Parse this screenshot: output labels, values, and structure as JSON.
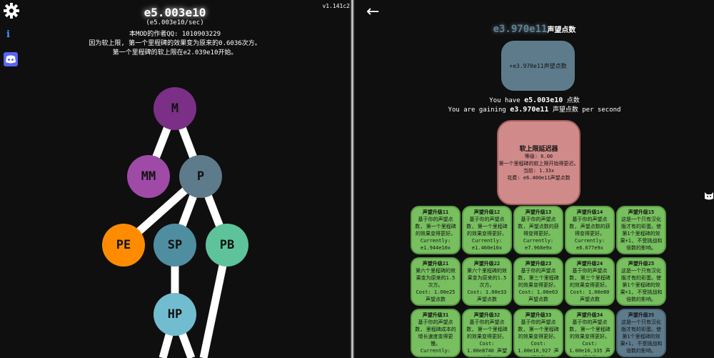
{
  "version": "v1.141c2",
  "left": {
    "points": "e5.003e10",
    "per_sec": "(e5.003e10/sec)",
    "author_line": "本MOD的作者QQ: 1010903229",
    "softcap_line": "因为软上限, 第一个里程碑的效果变为原来的0.6036次方。",
    "softcap_start_line": "第一个里程碑的软上限在e2.039e10开始。",
    "nodes": [
      {
        "key": "m",
        "label": "M",
        "color": "#7b2f86"
      },
      {
        "key": "mm",
        "label": "MM",
        "color": "#a04aa8"
      },
      {
        "key": "p",
        "label": "P",
        "color": "#5e7b8c"
      },
      {
        "key": "pe",
        "label": "PE",
        "color": "#ff8c00"
      },
      {
        "key": "sp",
        "label": "SP",
        "color": "#4f8ea0"
      },
      {
        "key": "pb",
        "label": "PB",
        "color": "#5ec39a"
      },
      {
        "key": "hp",
        "label": "HP",
        "color": "#72bccf"
      }
    ],
    "icons": {
      "settings": "gear-icon",
      "info": "info-icon",
      "discord": "discord-icon"
    }
  },
  "right": {
    "back_arrow": "←",
    "prestige_points": "e3.970e11",
    "prestige_name": "声望点数",
    "reset_button": "+e3.970e11声望点数",
    "you_have_prefix": "You have",
    "you_have_value": "e5.003e10",
    "you_have_suffix": "点数",
    "gaining_prefix": "You are gaining",
    "gaining_value": "e3.970e11",
    "gaining_suffix": "声望点数 per second",
    "buyable": {
      "title": "软上限延迟器",
      "level": "等级: 6.00",
      "desc": "第一个里程碑的软上限开始得更迟。当前: 1.33x",
      "cost": "花费: e6.400e11声望点数"
    },
    "upgrades": [
      {
        "title": "声望升级11",
        "desc": "基于你的声望点数, 第一个里程碑的效果变得更好。",
        "extra": "Currently: e1.944e10x"
      },
      {
        "title": "声望升级12",
        "desc": "基于你的声望点数, 第一个里程碑的效果变得更好。",
        "extra": "Currently: e1.460e10x"
      },
      {
        "title": "声望升级13",
        "desc": "基于你的声望点数, 声望点数的获得变得更好。",
        "extra": "Currently: e7.968e9x"
      },
      {
        "title": "声望升级14",
        "desc": "基于你的声望点数, 声望点数的获得变得更好。",
        "extra": "Currently: e6.677e9x"
      },
      {
        "title": "声望升级15",
        "desc": "这是一个只有汉化版才有的彩蛋。使第1个里程碑的效果+1, 不受挑战和倍数的影响。",
        "extra": ""
      },
      {
        "title": "声望升级21",
        "desc": "第六个里程碑的效果变为原来的1.5次方。",
        "extra": "Cost: 1.00e25 声望点数"
      },
      {
        "title": "声望升级22",
        "desc": "第六个里程碑的效果变为原来的1.5次方。",
        "extra": "Cost: 1.00e33 声望点数"
      },
      {
        "title": "声望升级23",
        "desc": "基于你的声望点数, 第三个里程碑的效果变得更好。",
        "extra": "Cost: 1.00e63 声望点数"
      },
      {
        "title": "声望升级24",
        "desc": "基于你的声望点数, 第三个里程碑的效果变得更好。",
        "extra": "Cost: 1.00e80 声望点数"
      },
      {
        "title": "声望升级25",
        "desc": "这是一个只有汉化版才有的彩蛋。使第1个里程碑的效果+1, 不受挑战和倍数的影响。",
        "extra": ""
      },
      {
        "title": "声望升级31",
        "desc": "基于你的声望点数, 里程碑成本的增长速度变得更慢。",
        "extra": "Currently: 1.5965x"
      },
      {
        "title": "声望升级32",
        "desc": "基于你的声望点数, 第一个里程碑的效果变得更好。",
        "extra": "Cost: 1.00e8740 声望点数"
      },
      {
        "title": "声望升级33",
        "desc": "基于你的声望点数, 第一个里程碑的效果变得更好。",
        "extra": "Cost: 1.00e10,927 声望点数"
      },
      {
        "title": "声望升级34",
        "desc": "基于你的声望点数, 第一个里程碑的效果变得更好。",
        "extra": "Cost: 1.00e16,335 声望点数"
      },
      {
        "title": "声望升级35",
        "desc": "这是一个只有汉化版才有的彩蛋。使第1个里程碑的效果+1, 不受挑战和倍数的影响。",
        "extra": ""
      }
    ]
  }
}
